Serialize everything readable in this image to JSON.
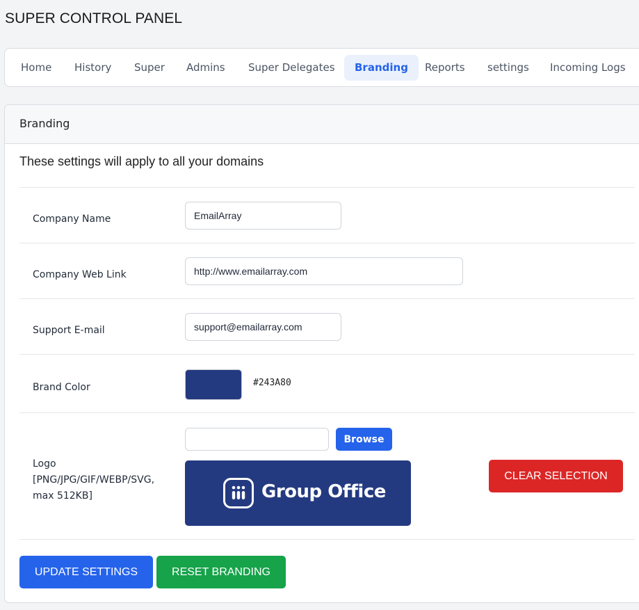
{
  "app": {
    "title": "SUPER CONTROL PANEL"
  },
  "nav": {
    "tabs": [
      {
        "label": "Home"
      },
      {
        "label": "History"
      },
      {
        "label": "Super"
      },
      {
        "label": "Admins"
      },
      {
        "label": "Super Delegates"
      },
      {
        "label": "Branding",
        "active": true
      },
      {
        "label": "Reports"
      },
      {
        "label": "settings"
      },
      {
        "label": "Incoming Logs"
      }
    ]
  },
  "card": {
    "title": "Branding",
    "intro": "These settings will apply to all your domains"
  },
  "form": {
    "company_name": {
      "label": "Company Name",
      "value": "EmailArray"
    },
    "company_web_link": {
      "label": "Company Web Link",
      "value": "http://www.emailarray.com"
    },
    "support_email": {
      "label": "Support E-mail",
      "value": "support@emailarray.com"
    },
    "brand_color": {
      "label": "Brand Color",
      "value": "#243A80"
    },
    "logo": {
      "label_line1": "Logo",
      "label_line2": "[PNG/JPG/GIF/WEBP/SVG,",
      "label_line3": "max 512KB]",
      "file_value": "",
      "browse_label": "Browse",
      "preview_text": "Group Office",
      "preview_icon": "group-office-logo-icon",
      "clear_label": "CLEAR SELECTION"
    }
  },
  "actions": {
    "update_label": "UPDATE SETTINGS",
    "reset_label": "RESET BRANDING"
  },
  "colors": {
    "primary": "#2563eb",
    "danger": "#dc2626",
    "success": "#16a34a",
    "brand": "#243A80"
  }
}
